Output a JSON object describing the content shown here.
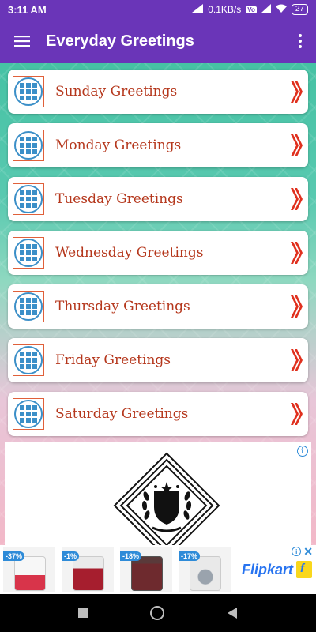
{
  "status_bar": {
    "time": "3:11 AM",
    "net_speed": "0.1KB/s",
    "net_badge": "Vo",
    "battery": "27"
  },
  "app_bar": {
    "title": "Everyday Greetings",
    "menu_icon": "hamburger-icon",
    "more_icon": "more-vert-icon"
  },
  "list": {
    "items": [
      {
        "label": "Sunday Greetings"
      },
      {
        "label": "Monday Greetings"
      },
      {
        "label": "Tuesday Greetings"
      },
      {
        "label": "Wednesday Greetings"
      },
      {
        "label": "Thursday Greetings"
      },
      {
        "label": "Friday Greetings"
      },
      {
        "label": "Saturday Greetings"
      }
    ],
    "icon": "grid-icon",
    "arrow_icon": "double-chevron-right-icon"
  },
  "banner_ad": {
    "products": [
      {
        "discount": "-37%"
      },
      {
        "discount": "-1%"
      },
      {
        "discount": "-18%"
      },
      {
        "discount": "-17%"
      }
    ],
    "brand": "Flipkart"
  },
  "colors": {
    "primary": "#6a35b8",
    "label": "#b5371c",
    "arrow": "#e0301e",
    "icon_blue": "#3b8fc8"
  }
}
